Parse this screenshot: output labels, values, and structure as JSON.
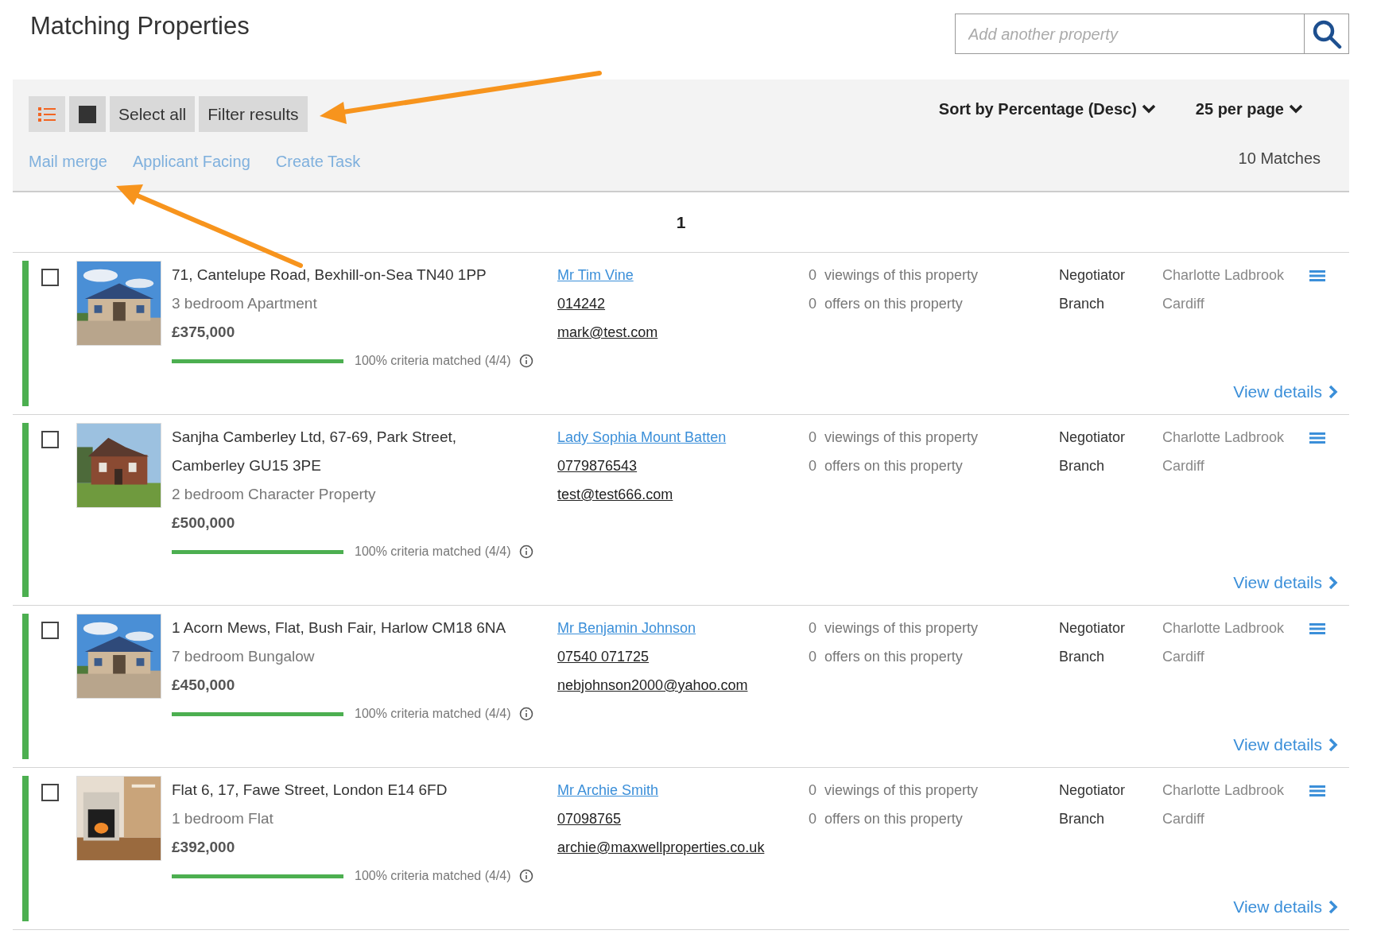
{
  "title": "Matching Properties",
  "search": {
    "placeholder": "Add another property"
  },
  "toolbar": {
    "view_toggles": [
      {
        "kind": "list",
        "selected": true
      },
      {
        "kind": "grid",
        "selected": false
      }
    ],
    "buttons": [
      "Select all",
      "Filter results"
    ],
    "sort": "Sort by Percentage (Desc)",
    "per_page": "25 per page",
    "links": [
      "Mail merge",
      "Applicant Facing",
      "Create Task"
    ],
    "matches": "10 Matches"
  },
  "pagination": [
    {
      "label": "1",
      "selected": true
    }
  ],
  "properties": [
    {
      "checked": false,
      "address": "71, Cantelupe Road, Bexhill-on-Sea TN40 1PP",
      "description": "3 bedroom Apartment",
      "price": "£375,000",
      "match": {
        "level": 1,
        "text": "100% criteria matched (4/4)"
      },
      "contact": {
        "name": "Mr Tim Vine",
        "phone": "014242",
        "email": "mark@test.com"
      },
      "viewings": {
        "count": "0",
        "text": "viewings of this property"
      },
      "offers": {
        "count": "0",
        "text": "offers on this property"
      },
      "negotiator": {
        "label": "Negotiator",
        "value": "Charlotte Ladbrook"
      },
      "branch": {
        "label": "Branch",
        "value": "Cardiff"
      },
      "view_details": "View details"
    },
    {
      "checked": false,
      "address": "Sanjha Camberley Ltd, 67-69, Park Street, Camberley GU15 3PE",
      "description": "2 bedroom Character Property",
      "price": "£500,000",
      "match": {
        "level": 1,
        "text": "100% criteria matched (4/4)"
      },
      "contact": {
        "name": "Lady Sophia Mount Batten",
        "phone": "0779876543",
        "email": "test@test666.com"
      },
      "viewings": {
        "count": "0",
        "text": "viewings of this property"
      },
      "offers": {
        "count": "0",
        "text": "offers on this property"
      },
      "negotiator": {
        "label": "Negotiator",
        "value": "Charlotte Ladbrook"
      },
      "branch": {
        "label": "Branch",
        "value": "Cardiff"
      },
      "view_details": "View details"
    },
    {
      "checked": false,
      "address": "1 Acorn Mews, Flat, Bush Fair, Harlow CM18 6NA",
      "description": "7 bedroom Bungalow",
      "price": "£450,000",
      "match": {
        "level": 1,
        "text": "100% criteria matched (4/4)"
      },
      "contact": {
        "name": "Mr Benjamin Johnson",
        "phone": "07540 071725",
        "email": "nebjohnson2000@yahoo.com"
      },
      "viewings": {
        "count": "0",
        "text": "viewings of this property"
      },
      "offers": {
        "count": "0",
        "text": "offers on this property"
      },
      "negotiator": {
        "label": "Negotiator",
        "value": "Charlotte Ladbrook"
      },
      "branch": {
        "label": "Branch",
        "value": "Cardiff"
      },
      "view_details": "View details"
    },
    {
      "checked": false,
      "address": "Flat 6, 17, Fawe Street, London E14 6FD",
      "description": "1 bedroom Flat",
      "price": "£392,000",
      "match": {
        "level": 1,
        "text": "100% criteria matched (4/4)"
      },
      "contact": {
        "name": "Mr Archie Smith",
        "phone": "07098765",
        "email": "archie@maxwellproperties.co.uk"
      },
      "viewings": {
        "count": "0",
        "text": "viewings of this property"
      },
      "offers": {
        "count": "0",
        "text": "offers on this property"
      },
      "negotiator": {
        "label": "Negotiator",
        "value": "Charlotte Ladbrook"
      },
      "branch": {
        "label": "Branch",
        "value": "Cardiff"
      },
      "view_details": "View details"
    }
  ]
}
